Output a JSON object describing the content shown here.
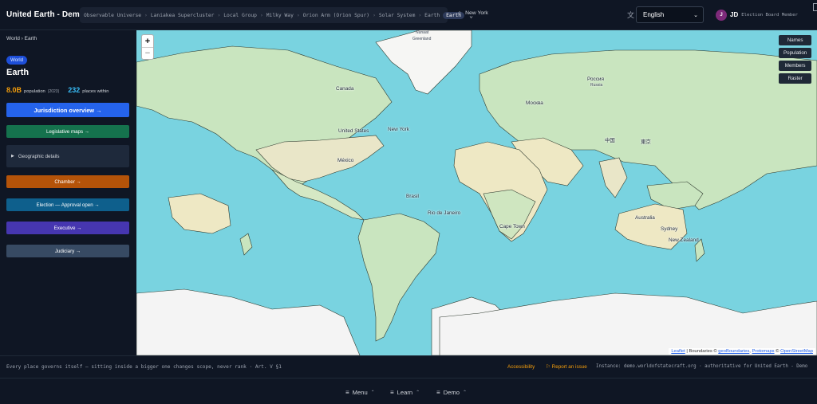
{
  "header": {
    "app_title": "United Earth - Demo",
    "breadcrumb": [
      "Observable Universe",
      "Laniakea Supercluster",
      "Local Group",
      "Milky Way",
      "Orion Arm (Orion Spur)",
      "Solar System",
      "Earth"
    ],
    "breadcrumb_current": "Earth",
    "home_location": "New York",
    "language": "English",
    "user": {
      "avatar_letter": "J",
      "initials": "JD",
      "role": "Election Board Member"
    }
  },
  "sidebar": {
    "crumb": "World › Earth",
    "badge": "World",
    "title": "Earth",
    "population_value": "8.0B",
    "population_label": "population",
    "population_year": "(2023)",
    "places_value": "232",
    "places_label": "places within",
    "buttons": {
      "jurisdiction": "Jurisdiction overview →",
      "legislative": "Legislative maps →",
      "geographic": "Geographic details",
      "chamber": "Chamber →",
      "election": "Election — Approval open →",
      "executive": "Executive →",
      "judiciary": "Judiciary →"
    }
  },
  "map": {
    "zoom_in": "+",
    "zoom_out": "−",
    "layers": [
      "Names",
      "Population",
      "Members",
      "Raster"
    ],
    "attribution": {
      "leaflet": "Leaflet",
      "boundaries": "| Boundaries ©",
      "geoboundaries": "geoBoundaries",
      "protomaps": "Protomaps",
      "osm": "OpenStreetMap"
    },
    "labels": {
      "nunaat": "Nunaat",
      "greenland": "Greenland",
      "canada": "Canada",
      "united_states": "United States",
      "new_york": "New York",
      "mexico": "México",
      "brasil": "Brasil",
      "rio": "Rio de Janeiro",
      "moscow": "Москва",
      "rossiya": "Россия",
      "russia": "Russia",
      "china": "中国",
      "tokyo": "東京",
      "australia": "Australia",
      "sydney": "Sydney",
      "nz": "New Zealand",
      "cape_town": "Cape Town"
    }
  },
  "footer": {
    "motto": "Every place governs itself — sitting inside a bigger one changes scope, never rank · Art. V §1",
    "accessibility": "Accessibility",
    "report": "Report an issue",
    "instance": "Instance: demo.worldofstatecraft.org · authoritative for United Earth - Demo"
  },
  "bottom_nav": {
    "menu": "Menu",
    "learn": "Learn",
    "demo": "Demo"
  },
  "colors": {
    "ocean": "#79d3e0",
    "land": "#c5e3bc",
    "desert": "#eee8c4",
    "ice": "#f4f4f4",
    "accent_orange": "#f59e0b",
    "accent_blue": "#2563eb"
  }
}
